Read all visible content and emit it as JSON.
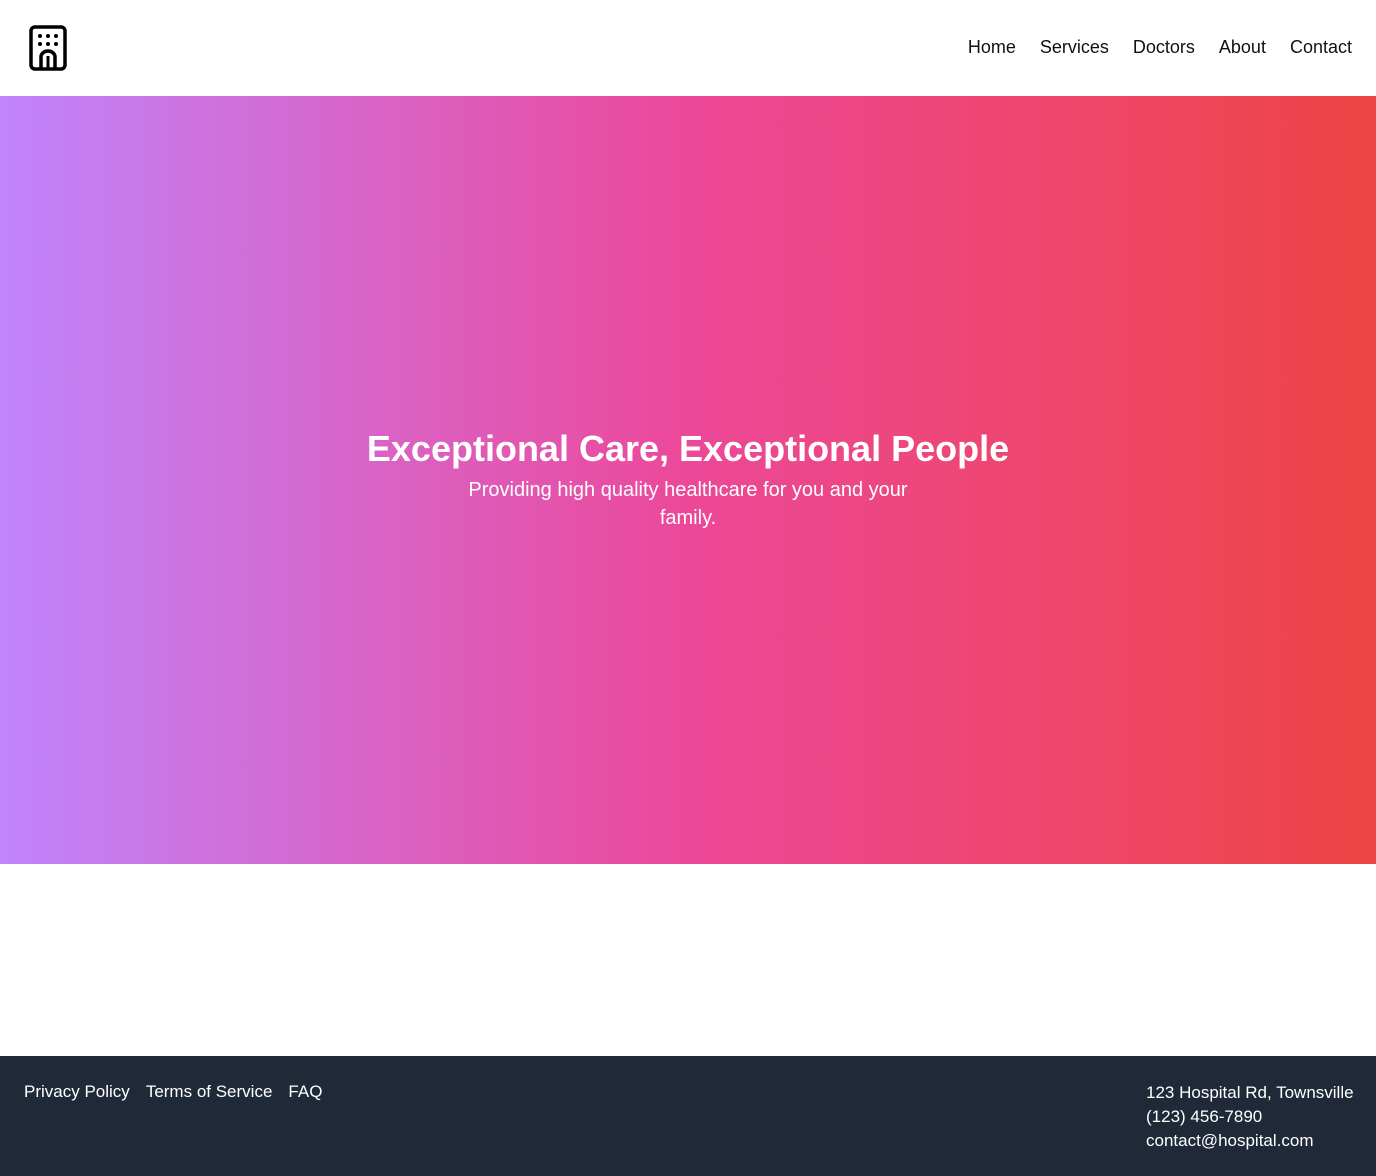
{
  "header": {
    "logo_icon": "hospital-building-icon",
    "nav": [
      {
        "label": "Home"
      },
      {
        "label": "Services"
      },
      {
        "label": "Doctors"
      },
      {
        "label": "About"
      },
      {
        "label": "Contact"
      }
    ]
  },
  "hero": {
    "title": "Exceptional Care, Exceptional People",
    "subtitle": "Providing high quality healthcare for you and your family.",
    "gradient": {
      "start": "#c084fc",
      "middle": "#ec4899",
      "end": "#ef4444"
    }
  },
  "footer": {
    "links": [
      {
        "label": "Privacy Policy"
      },
      {
        "label": "Terms of Service"
      },
      {
        "label": "FAQ"
      }
    ],
    "contact": {
      "address": "123 Hospital Rd, Townsville",
      "phone": "(123) 456-7890",
      "email": "contact@hospital.com"
    },
    "background": "#1f2937"
  }
}
